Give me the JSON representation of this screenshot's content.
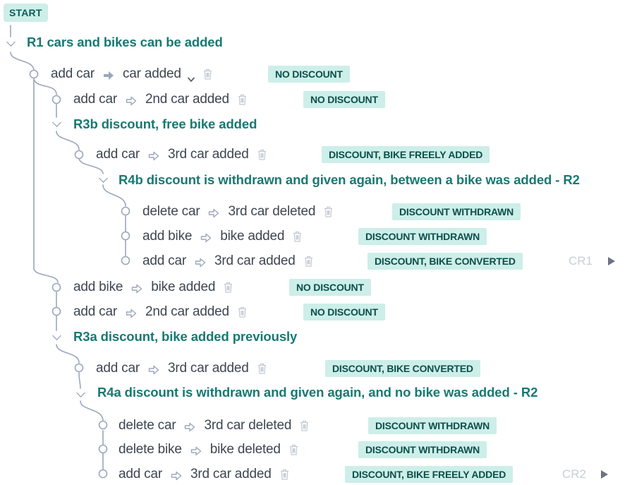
{
  "colors": {
    "accent": "#177a72",
    "tag_bg": "#cdeee9",
    "tag_text": "#0c4f4a",
    "line": "#9aa7bc",
    "text": "#3e4651",
    "muted": "#c8ced8"
  },
  "start": {
    "label": "START"
  },
  "rules": {
    "r1": "R1 cars and bikes can be added",
    "r3b": "R3b discount, free bike added",
    "r4b": "R4b discount is withdrawn and given again, between a bike was added - R2",
    "r3a": "R3a discount, bike added previously",
    "r4a": "R4a discount is withdrawn and given again, and no bike was added - R2"
  },
  "steps": [
    {
      "action": "add car",
      "result": "car added",
      "tag": "NO DISCOUNT",
      "arrow": "solid",
      "collapse_icon": "chevron-down-icon"
    },
    {
      "action": "add car",
      "result": "2nd car added",
      "tag": "NO DISCOUNT",
      "arrow": "outline"
    },
    {
      "action": "add car",
      "result": "3rd car added",
      "tag": "DISCOUNT, BIKE FREELY ADDED",
      "arrow": "outline"
    },
    {
      "action": "delete car",
      "result": "3rd car deleted",
      "tag": "DISCOUNT WITHDRAWN",
      "arrow": "outline"
    },
    {
      "action": "add bike",
      "result": "bike added",
      "tag": "DISCOUNT WITHDRAWN",
      "arrow": "outline"
    },
    {
      "action": "add car",
      "result": "3rd car added",
      "tag": "DISCOUNT, BIKE CONVERTED",
      "arrow": "outline",
      "cr": "CR1"
    },
    {
      "action": "add bike",
      "result": "bike added",
      "tag": "NO DISCOUNT",
      "arrow": "outline"
    },
    {
      "action": "add car",
      "result": "2nd car added",
      "tag": "NO DISCOUNT",
      "arrow": "outline"
    },
    {
      "action": "add car",
      "result": "3rd  car added",
      "tag": "DISCOUNT, BIKE CONVERTED",
      "arrow": "outline"
    },
    {
      "action": "delete car",
      "result": "3rd car deleted",
      "tag": "DISCOUNT WITHDRAWN",
      "arrow": "outline"
    },
    {
      "action": "delete bike",
      "result": "bike deleted",
      "tag": "DISCOUNT WITHDRAWN",
      "arrow": "outline"
    },
    {
      "action": "add car",
      "result": "3rd car added",
      "tag": "DISCOUNT, BIKE FREELY ADDED",
      "arrow": "outline",
      "cr": "CR2"
    }
  ],
  "icons": {
    "trash": "trash-icon",
    "arrow": "arrow-right-icon",
    "node": "node-circle-icon",
    "expand": "chevron-down-icon",
    "run": "play-icon"
  }
}
